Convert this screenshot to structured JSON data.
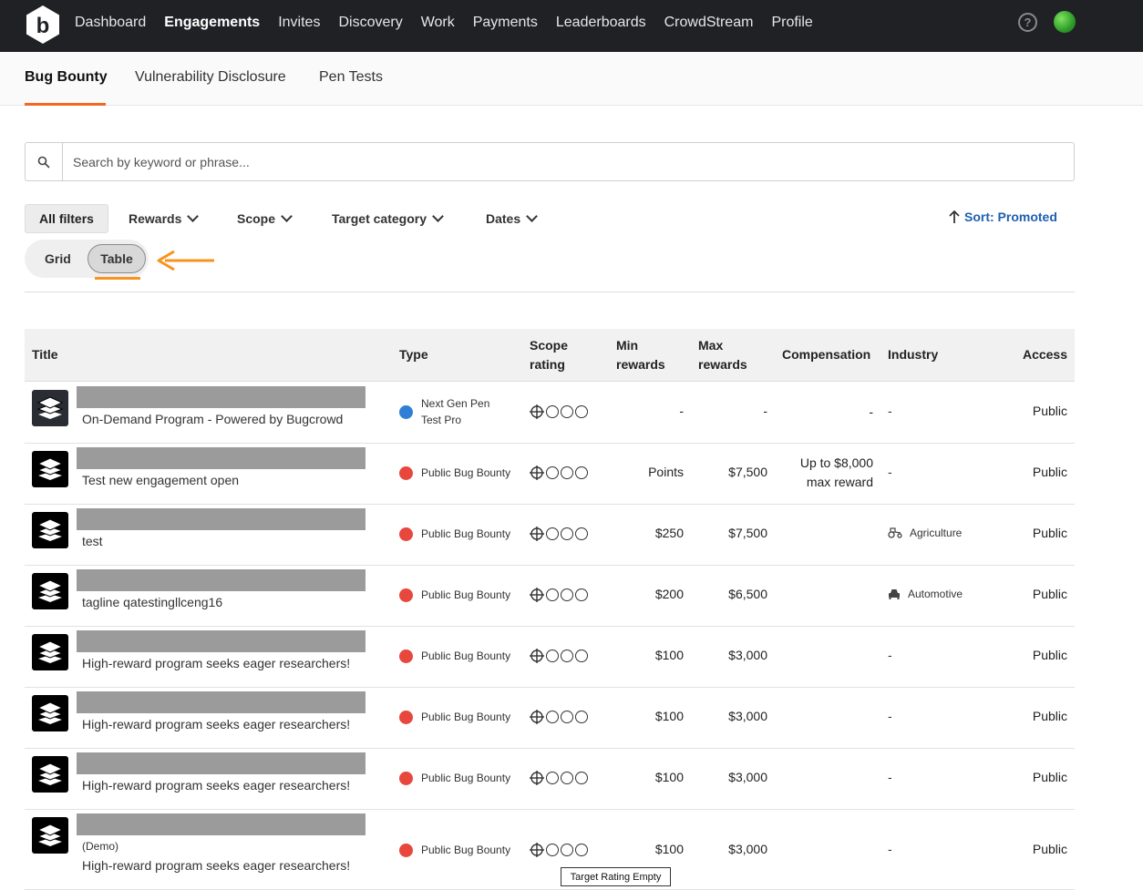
{
  "nav": {
    "logo_letter": "b",
    "links": [
      "Dashboard",
      "Engagements",
      "Invites",
      "Discovery",
      "Work",
      "Payments",
      "Leaderboards",
      "CrowdStream",
      "Profile"
    ],
    "active": "Engagements",
    "help_label": "?"
  },
  "subtabs": [
    "Bug Bounty",
    "Vulnerability Disclosure",
    "Pen Tests"
  ],
  "search": {
    "placeholder": "Search by keyword or phrase..."
  },
  "filters": {
    "all_filters": "All filters",
    "rewards": "Rewards",
    "scope": "Scope",
    "target_category": "Target category",
    "dates": "Dates",
    "sort": "Sort: Promoted"
  },
  "view_toggle": {
    "grid": "Grid",
    "table": "Table",
    "selected": "Table"
  },
  "table": {
    "headers": {
      "title": "Title",
      "type": "Type",
      "scope_rating_1": "Scope",
      "scope_rating_2": "rating",
      "min_rewards_1": "Min",
      "min_rewards_2": "rewards",
      "max_rewards_1": "Max",
      "max_rewards_2": "rewards",
      "compensation": "Compensation",
      "industry": "Industry",
      "access": "Access"
    },
    "rows": [
      {
        "tagline": "On-Demand Program - Powered by Bugcrowd",
        "type_1": "Next Gen Pen",
        "type_2": "Test Pro",
        "type_color": "blue",
        "min": "-",
        "max": "-",
        "comp_1": "-",
        "comp_2": "",
        "industry": "-",
        "industry_icon": "",
        "access": "Public",
        "demo": ""
      },
      {
        "tagline": "Test new engagement open",
        "type_1": "Public Bug Bounty",
        "type_2": "",
        "type_color": "red",
        "min": "Points",
        "max": "$7,500",
        "comp_1": "Up to $8,000",
        "comp_2": "max reward",
        "industry": "-",
        "industry_icon": "",
        "access": "Public",
        "demo": ""
      },
      {
        "tagline": "test",
        "type_1": "Public Bug Bounty",
        "type_2": "",
        "type_color": "red",
        "min": "$250",
        "max": "$7,500",
        "comp_1": "",
        "comp_2": "",
        "industry": "Agriculture",
        "industry_icon": "tractor-icon",
        "access": "Public",
        "demo": ""
      },
      {
        "tagline": "tagline qatestingllceng16",
        "type_1": "Public Bug Bounty",
        "type_2": "",
        "type_color": "red",
        "min": "$200",
        "max": "$6,500",
        "comp_1": "",
        "comp_2": "",
        "industry": "Automotive",
        "industry_icon": "car-icon",
        "access": "Public",
        "demo": ""
      },
      {
        "tagline": "High-reward program seeks eager researchers!",
        "type_1": "Public Bug Bounty",
        "type_2": "",
        "type_color": "red",
        "min": "$100",
        "max": "$3,000",
        "comp_1": "",
        "comp_2": "",
        "industry": "-",
        "industry_icon": "",
        "access": "Public",
        "demo": ""
      },
      {
        "tagline": "High-reward program seeks eager researchers!",
        "type_1": "Public Bug Bounty",
        "type_2": "",
        "type_color": "red",
        "min": "$100",
        "max": "$3,000",
        "comp_1": "",
        "comp_2": "",
        "industry": "-",
        "industry_icon": "",
        "access": "Public",
        "demo": ""
      },
      {
        "tagline": "High-reward program seeks eager researchers!",
        "type_1": "Public Bug Bounty",
        "type_2": "",
        "type_color": "red",
        "min": "$100",
        "max": "$3,000",
        "comp_1": "",
        "comp_2": "",
        "industry": "-",
        "industry_icon": "",
        "access": "Public",
        "demo": ""
      },
      {
        "tagline": "High-reward program seeks eager researchers!",
        "type_1": "Public Bug Bounty",
        "type_2": "",
        "type_color": "red",
        "min": "$100",
        "max": "$3,000",
        "comp_1": "",
        "comp_2": "",
        "industry": "-",
        "industry_icon": "",
        "access": "Public",
        "demo": "(Demo)"
      }
    ]
  },
  "tooltip": "Target Rating Empty",
  "colors": {
    "accent": "#f26822",
    "sort_link": "#1f5fb0",
    "annotation": "#f7931e",
    "nav_bg": "#1f2124"
  }
}
